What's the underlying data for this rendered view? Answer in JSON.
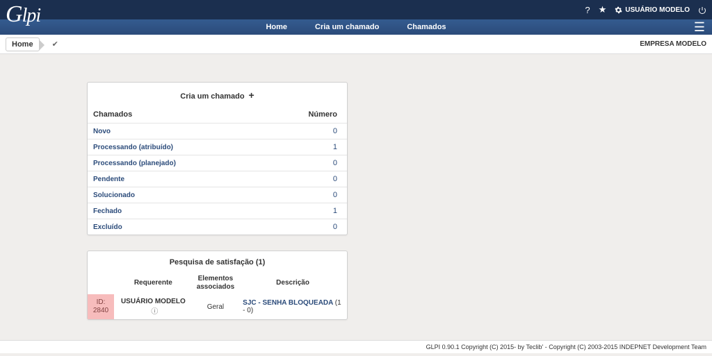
{
  "topbar": {
    "user_label": "USUÁRIO MODELO"
  },
  "nav": {
    "home": "Home",
    "create": "Cria um chamado",
    "tickets": "Chamados"
  },
  "breadcrumb": {
    "home": "Home",
    "company": "EMPRESA MODELO"
  },
  "panel_create": {
    "title": "Cria um chamado",
    "col_tickets": "Chamados",
    "col_number": "Número",
    "rows": [
      {
        "label": "Novo",
        "count": "0"
      },
      {
        "label": "Processando (atribuído)",
        "count": "1"
      },
      {
        "label": "Processando (planejado)",
        "count": "0"
      },
      {
        "label": "Pendente",
        "count": "0"
      },
      {
        "label": "Solucionado",
        "count": "0"
      },
      {
        "label": "Fechado",
        "count": "1"
      },
      {
        "label": "Excluído",
        "count": "0"
      }
    ]
  },
  "panel_survey": {
    "title": "Pesquisa de satisfação (1)",
    "col_requester": "Requerente",
    "col_elements_l1": "Elementos",
    "col_elements_l2": "associados",
    "col_desc": "Descrição",
    "row": {
      "id_label": "ID:",
      "id_value": "2840",
      "requester": "USUÁRIO MODELO",
      "elements": "Geral",
      "desc_link": "SJC - SENHA BLOQUEADA",
      "desc_extra": "(1 - 0)"
    }
  },
  "footer": {
    "text": "GLPI 0.90.1 Copyright (C) 2015- by Teclib' - Copyright (C) 2003-2015 INDEPNET Development Team"
  }
}
